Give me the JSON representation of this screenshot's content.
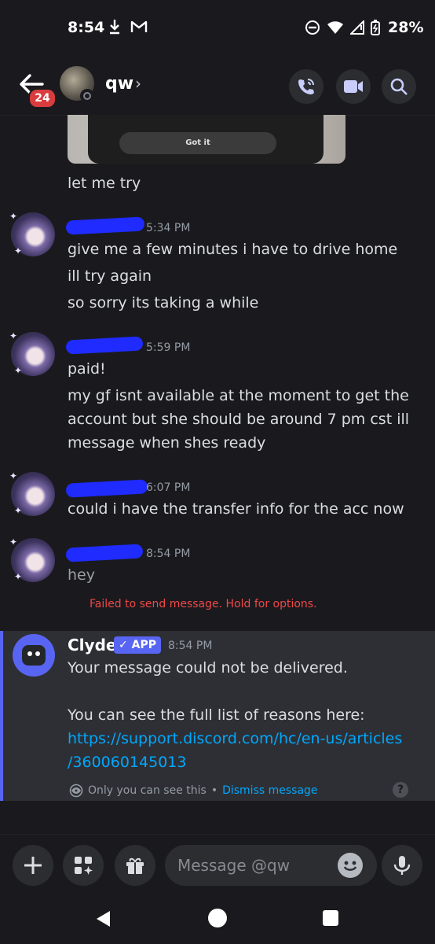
{
  "status_bar": {
    "time": "8:54",
    "battery": "28%",
    "icons": [
      "download-icon",
      "gmail-icon",
      "dnd-icon",
      "wifi-icon",
      "signal-icon",
      "battery-icon"
    ]
  },
  "header": {
    "unread_badge": "24",
    "channel_name": "qw",
    "chevron": "›",
    "actions": [
      "call-icon",
      "video-icon",
      "search-icon"
    ]
  },
  "messages": {
    "image_button_text": "Got it",
    "m0": "let me try",
    "g1": {
      "time": "5:34 PM",
      "lines": [
        "give me a few minutes i have to drive home",
        "ill try again",
        "so sorry its taking a while"
      ]
    },
    "g2": {
      "time": "5:59 PM",
      "lines": [
        "paid!",
        "my gf isnt available at the moment to get the",
        "account but she should be around 7 pm cst ill",
        "message when shes ready"
      ]
    },
    "g3": {
      "time": "6:07 PM",
      "lines": [
        "could i have the transfer info for the acc now"
      ]
    },
    "g4": {
      "time": "8:54 PM",
      "lines": [
        "hey"
      ],
      "failed": "Failed to send message. Hold for options."
    }
  },
  "clyde": {
    "name": "Clyde",
    "tag": "✓ APP",
    "time": "8:54 PM",
    "line1": "Your message could not be delivered.",
    "line2": "You can see the full list of reasons here:",
    "link1": "https://support.discord.com/hc/en-us/articles",
    "link2": "/360060145013",
    "only_you": "Only you can see this",
    "separator": "•",
    "dismiss": "Dismiss message",
    "help": "?"
  },
  "composer": {
    "placeholder": "Message @qw"
  },
  "colors": {
    "accent": "#5865f2",
    "link": "#00a8fc",
    "error": "#f04747",
    "badge": "#d83c3e"
  }
}
